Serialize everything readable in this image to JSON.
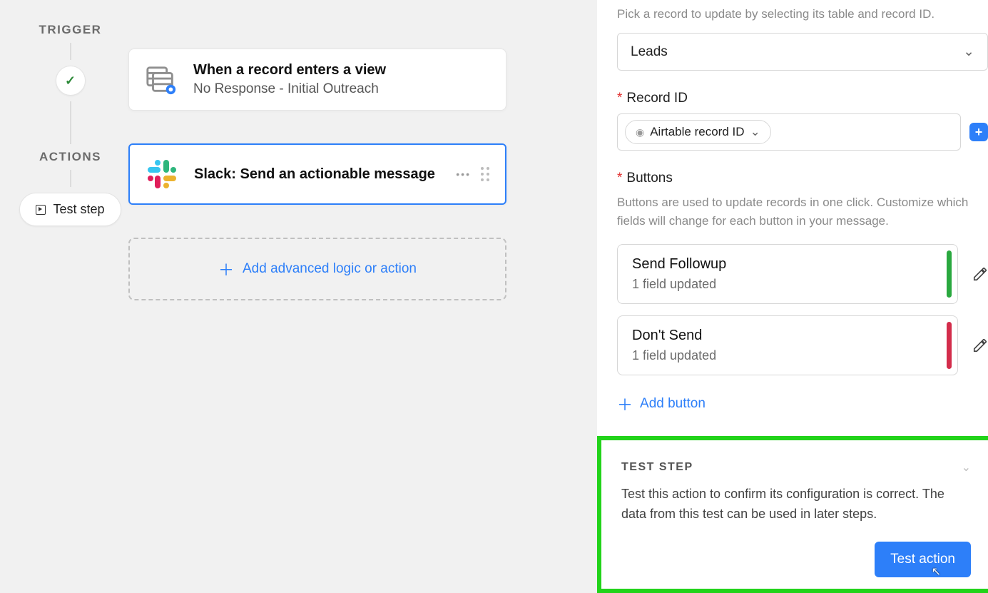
{
  "left": {
    "trigger_label": "TRIGGER",
    "actions_label": "ACTIONS",
    "test_step_label": "Test step",
    "trigger_card": {
      "title": "When a record enters a view",
      "subtitle": "No Response - Initial Outreach"
    },
    "action_card": {
      "title": "Slack: Send an actionable message"
    },
    "add_action_label": "Add advanced logic or action"
  },
  "right": {
    "pick_record_help": "Pick a record to update by selecting its table and record ID.",
    "table_select_value": "Leads",
    "record_id_label": "Record ID",
    "record_id_token": "Airtable record ID",
    "buttons_label": "Buttons",
    "buttons_help": "Buttons are used to update records in one click. Customize which fields will change for each button in your message.",
    "buttons": [
      {
        "title": "Send Followup",
        "sub": "1 field updated",
        "stripe": "green"
      },
      {
        "title": "Don't Send",
        "sub": "1 field updated",
        "stripe": "red"
      }
    ],
    "add_button_label": "Add button",
    "test_step": {
      "header": "TEST STEP",
      "desc": "Test this action to confirm its configuration is correct. The data from this test can be used in later steps.",
      "action_button": "Test action"
    }
  }
}
